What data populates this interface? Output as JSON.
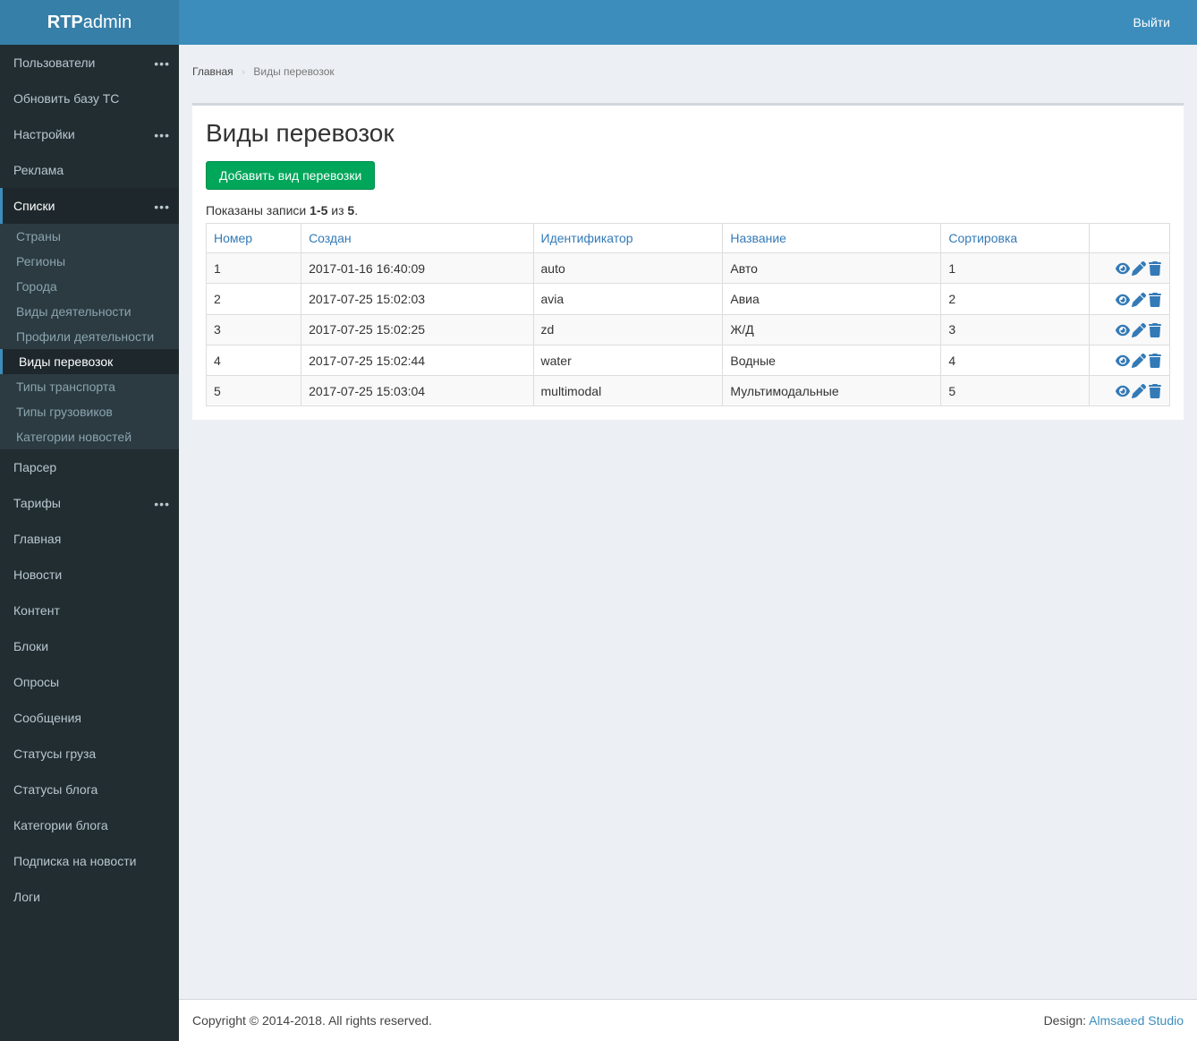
{
  "header": {
    "logo_bold": "RTP",
    "logo_light": "admin",
    "logout": "Выйти"
  },
  "sidebar": {
    "items": [
      {
        "label": "Пользователи",
        "has_menu": true
      },
      {
        "label": "Обновить базу ТС",
        "has_menu": false
      },
      {
        "label": "Настройки",
        "has_menu": true
      },
      {
        "label": "Реклама",
        "has_menu": false
      },
      {
        "label": "Списки",
        "has_menu": true,
        "active": true,
        "open": true
      },
      {
        "label": "Парсер",
        "has_menu": false
      },
      {
        "label": "Тарифы",
        "has_menu": true
      },
      {
        "label": "Главная",
        "has_menu": false
      },
      {
        "label": "Новости",
        "has_menu": false
      },
      {
        "label": "Контент",
        "has_menu": false
      },
      {
        "label": "Блоки",
        "has_menu": false
      },
      {
        "label": "Опросы",
        "has_menu": false
      },
      {
        "label": "Сообщения",
        "has_menu": false
      },
      {
        "label": "Статусы груза",
        "has_menu": false
      },
      {
        "label": "Статусы блога",
        "has_menu": false
      },
      {
        "label": "Категории блога",
        "has_menu": false
      },
      {
        "label": "Подписка на новости",
        "has_menu": false
      },
      {
        "label": "Логи",
        "has_menu": false
      }
    ],
    "submenu_lists": [
      {
        "label": "Страны"
      },
      {
        "label": "Регионы"
      },
      {
        "label": "Города"
      },
      {
        "label": "Виды деятельности"
      },
      {
        "label": "Профили деятельности"
      },
      {
        "label": "Виды перевозок",
        "active": true
      },
      {
        "label": "Типы транспорта"
      },
      {
        "label": "Типы грузовиков"
      },
      {
        "label": "Категории новостей"
      }
    ]
  },
  "breadcrumb": {
    "home": "Главная",
    "current": "Виды перевозок"
  },
  "page": {
    "title": "Виды перевозок",
    "add_button": "Добавить вид перевозки",
    "summary_prefix": "Показаны записи ",
    "summary_range": "1-5",
    "summary_mid": " из ",
    "summary_total": "5",
    "summary_suffix": "."
  },
  "table": {
    "headers": {
      "number": "Номер",
      "created": "Создан",
      "identifier": "Идентификатор",
      "name": "Название",
      "sort": "Сортировка"
    },
    "rows": [
      {
        "number": "1",
        "created": "2017-01-16 16:40:09",
        "identifier": "auto",
        "name": "Авто",
        "sort": "1"
      },
      {
        "number": "2",
        "created": "2017-07-25 15:02:03",
        "identifier": "avia",
        "name": "Авиа",
        "sort": "2"
      },
      {
        "number": "3",
        "created": "2017-07-25 15:02:25",
        "identifier": "zd",
        "name": "Ж/Д",
        "sort": "3"
      },
      {
        "number": "4",
        "created": "2017-07-25 15:02:44",
        "identifier": "water",
        "name": "Водные",
        "sort": "4"
      },
      {
        "number": "5",
        "created": "2017-07-25 15:03:04",
        "identifier": "multimodal",
        "name": "Мультимодальные",
        "sort": "5"
      }
    ]
  },
  "footer": {
    "copyright": "Copyright © 2014-2018. All rights reserved.",
    "design_label": "Design: ",
    "design_link": "Almsaeed Studio"
  }
}
